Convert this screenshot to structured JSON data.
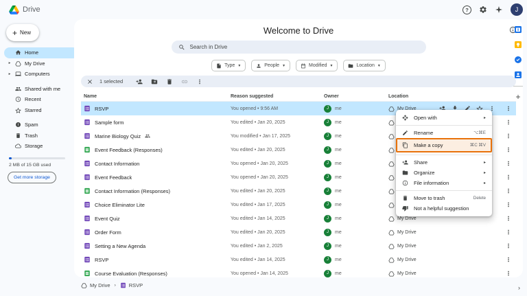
{
  "header": {
    "app_name": "Drive",
    "avatar_initial": "J"
  },
  "sidebar": {
    "new_label": "New",
    "items": [
      {
        "label": "Home",
        "icon": "home",
        "selected": true
      },
      {
        "label": "My Drive",
        "icon": "drive-outline",
        "expand": true
      },
      {
        "label": "Computers",
        "icon": "monitor",
        "expand": true,
        "group_end": true
      },
      {
        "label": "Shared with me",
        "icon": "people"
      },
      {
        "label": "Recent",
        "icon": "clock"
      },
      {
        "label": "Starred",
        "icon": "star-outline",
        "group_end": true
      },
      {
        "label": "Spam",
        "icon": "alert"
      },
      {
        "label": "Trash",
        "icon": "trash"
      },
      {
        "label": "Storage",
        "icon": "cloud"
      }
    ],
    "storage_text": "2 MB of 15 GB used",
    "storage_button": "Get more storage"
  },
  "main": {
    "title": "Welcome to Drive",
    "search_placeholder": "Search in Drive",
    "filter_chips": [
      {
        "label": "Type",
        "icon": "file"
      },
      {
        "label": "People",
        "icon": "person"
      },
      {
        "label": "Modified",
        "icon": "calendar"
      },
      {
        "label": "Location",
        "icon": "folder"
      }
    ],
    "toolbar": {
      "selected_count": "1 selected",
      "actions": [
        "person-add",
        "folder-move",
        "trash",
        "link",
        "more-vert"
      ]
    },
    "table": {
      "columns": [
        "Name",
        "Reason suggested",
        "Owner",
        "Location"
      ],
      "owner_initial": "J",
      "row_actions": [
        "person-add",
        "download",
        "pencil",
        "star-outline",
        "more-vert"
      ],
      "rows": [
        {
          "name": "RSVP",
          "type": "form",
          "reason": "You opened • 9:56 AM",
          "owner": "me",
          "location": "My Drive",
          "selected": true
        },
        {
          "name": "Sample form",
          "type": "form",
          "reason": "You edited • Jan 20, 2025",
          "owner": "me",
          "location": "My Drive"
        },
        {
          "name": "Marine Biology Quiz",
          "type": "form",
          "shared": true,
          "reason": "You modified • Jan 17, 2025",
          "owner": "me",
          "location": "My Drive"
        },
        {
          "name": "Event Feedback (Responses)",
          "type": "sheet",
          "reason": "You edited • Jan 20, 2025",
          "owner": "me",
          "location": "My Drive"
        },
        {
          "name": "Contact Information",
          "type": "form",
          "reason": "You opened • Jan 20, 2025",
          "owner": "me",
          "location": "My Drive"
        },
        {
          "name": "Event Feedback",
          "type": "form",
          "reason": "You opened • Jan 20, 2025",
          "owner": "me",
          "location": "My Drive"
        },
        {
          "name": "Contact Information (Responses)",
          "type": "sheet",
          "reason": "You edited • Jan 20, 2025",
          "owner": "me",
          "location": "My Drive"
        },
        {
          "name": "Choice Eliminator Lite",
          "type": "form",
          "reason": "You edited • Jan 17, 2025",
          "owner": "me",
          "location": "My Drive"
        },
        {
          "name": "Event Quiz",
          "type": "form",
          "reason": "You edited • Jan 14, 2025",
          "owner": "me",
          "location": "My Drive"
        },
        {
          "name": "Order Form",
          "type": "form",
          "reason": "You edited • Jan 20, 2025",
          "owner": "me",
          "location": "My Drive"
        },
        {
          "name": "Setting a New Agenda",
          "type": "form",
          "reason": "You edited • Jan 2, 2025",
          "owner": "me",
          "location": "My Drive"
        },
        {
          "name": "RSVP",
          "type": "form",
          "reason": "You edited • Jan 14, 2025",
          "owner": "me",
          "location": "My Drive"
        },
        {
          "name": "Course Evaluation (Responses)",
          "type": "sheet",
          "reason": "You opened • Jan 14, 2025",
          "owner": "me",
          "location": "My Drive"
        }
      ]
    }
  },
  "context_menu": {
    "items": [
      {
        "label": "Open with",
        "icon": "open-with",
        "submenu": true
      },
      {
        "divider": true
      },
      {
        "label": "Rename",
        "icon": "pencil",
        "shortcut": "⌥⌘E"
      },
      {
        "label": "Make a copy",
        "icon": "copy",
        "shortcut": "⌘C ⌘V",
        "highlighted": true
      },
      {
        "divider": true
      },
      {
        "label": "Share",
        "icon": "person-add",
        "submenu": true
      },
      {
        "label": "Organize",
        "icon": "folder",
        "submenu": true
      },
      {
        "label": "File information",
        "icon": "info",
        "submenu": true
      },
      {
        "divider": true
      },
      {
        "label": "Move to trash",
        "icon": "trash",
        "shortcut": "Delete"
      },
      {
        "label": "Not a helpful suggestion",
        "icon": "thumb-down"
      }
    ]
  },
  "footer": {
    "breadcrumb": [
      {
        "label": "My Drive",
        "icon": "drive-outline"
      },
      {
        "label": "RSVP",
        "icon": "form"
      }
    ]
  },
  "rail": {
    "apps": [
      "calendar",
      "keep",
      "tasks",
      "contacts"
    ]
  },
  "colors": {
    "selection": "#c2e7ff",
    "form_icon": "#7248b9",
    "sheet_icon": "#34a853",
    "highlight_border": "#e8710a",
    "background": "#f8fafd",
    "accent_blue": "#0b57d0"
  }
}
